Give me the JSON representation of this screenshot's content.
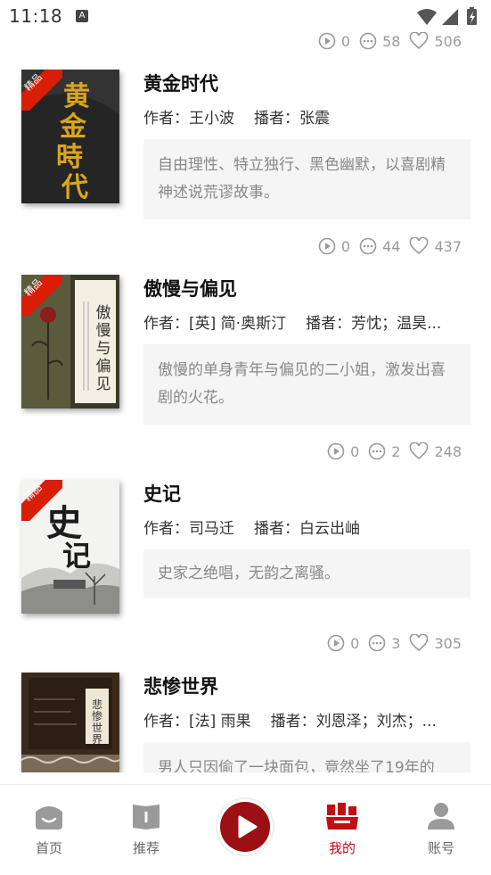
{
  "status": {
    "time": "11:18",
    "notification_icon": "A"
  },
  "first_stats": {
    "plays": "0",
    "comments": "58",
    "likes": "506"
  },
  "books": [
    {
      "title": "黄金时代",
      "author_label": "作者：",
      "author": "王小波",
      "narrator_label": "播者：",
      "narrator": "张震",
      "description": "自由理性、特立独行、黑色幽默，以喜剧精神述说荒谬故事。",
      "badge": "精品",
      "cover_title": "黄金时代",
      "stats": {
        "plays": "0",
        "comments": "44",
        "likes": "437"
      }
    },
    {
      "title": "傲慢与偏见",
      "author_label": "作者：",
      "author": "[英] 简·奥斯汀",
      "narrator_label": "播者：",
      "narrator": "芳忱；温昊...",
      "description": "傲慢的单身青年与偏见的二小姐，激发出喜剧的火花。",
      "badge": "精品",
      "cover_title": "傲慢与偏见",
      "stats": {
        "plays": "0",
        "comments": "2",
        "likes": "248"
      }
    },
    {
      "title": "史记",
      "author_label": "作者：",
      "author": "司马迁",
      "narrator_label": "播者：",
      "narrator": "白云出岫",
      "description": "史家之绝唱，无韵之离骚。",
      "badge": "精品",
      "cover_title": "史记",
      "stats": {
        "plays": "0",
        "comments": "3",
        "likes": "305"
      }
    },
    {
      "title": "悲惨世界",
      "author_label": "作者：",
      "author": "[法] 雨果",
      "narrator_label": "播者：",
      "narrator": "刘恩泽；刘杰；...",
      "description": "男人只因偷了一块面包，竟然坐了19年的",
      "cover_title": "悲惨世界"
    }
  ],
  "tabbar": {
    "home": "首页",
    "recommend": "推荐",
    "mine": "我的",
    "account": "账号"
  },
  "colors": {
    "accent": "#c40d12",
    "play_button": "#9c0f15",
    "badge": "#d81e06"
  },
  "icons": [
    "play-circle-icon",
    "comment-icon",
    "heart-icon",
    "home-icon",
    "book-icon",
    "play-icon",
    "library-icon",
    "user-icon"
  ]
}
